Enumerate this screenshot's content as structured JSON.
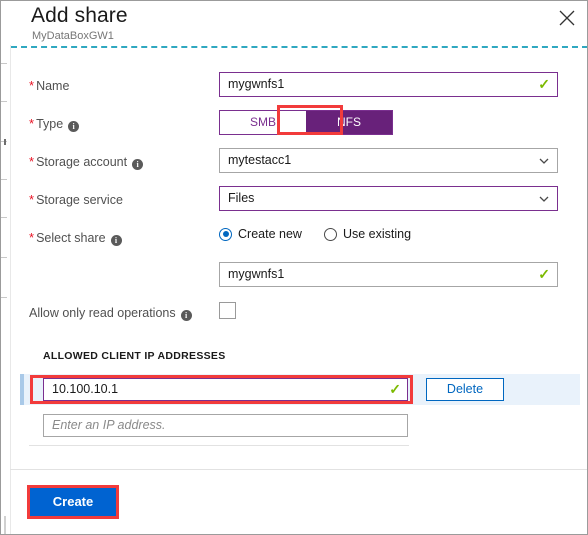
{
  "window": {
    "title": "Add share",
    "subtitle": "MyDataBoxGW1",
    "close_icon": "close-icon"
  },
  "form": {
    "fields": [
      {
        "label": "Name",
        "required": true,
        "has_info": false,
        "value": "mygwnfs1",
        "valid": true
      },
      {
        "label": "Type",
        "required": true,
        "has_info": true,
        "options": [
          "SMB",
          "NFS"
        ],
        "selected": "NFS"
      },
      {
        "label": "Storage account",
        "required": true,
        "has_info": true,
        "value": "mytestacc1"
      },
      {
        "label": "Storage service",
        "required": true,
        "has_info": false,
        "value": "Files"
      },
      {
        "label": "Select share",
        "required": true,
        "has_info": true,
        "radios": [
          "Create new",
          "Use existing"
        ],
        "selected_radio": "Create new",
        "share_name": "mygwnfs1",
        "share_valid": true
      },
      {
        "label": "Allow only read operations",
        "required": false,
        "has_info": true,
        "checked": false
      }
    ]
  },
  "ip_section": {
    "heading": "ALLOWED CLIENT IP ADDRESSES",
    "rows": [
      {
        "value": "10.100.10.1",
        "valid": true,
        "delete_label": "Delete"
      }
    ],
    "new_row_placeholder": "Enter an IP address."
  },
  "footer": {
    "create_label": "Create"
  },
  "colors": {
    "accent_purple": "#68217A",
    "accent_blue": "#0063D1",
    "link_blue": "#0067C0",
    "valid_green": "#7CBA00",
    "required_red": "#E81123",
    "highlight_red": "#F23B3B",
    "divider_teal": "#2FA8C0",
    "row_selected_bg": "#E9F2FB"
  }
}
